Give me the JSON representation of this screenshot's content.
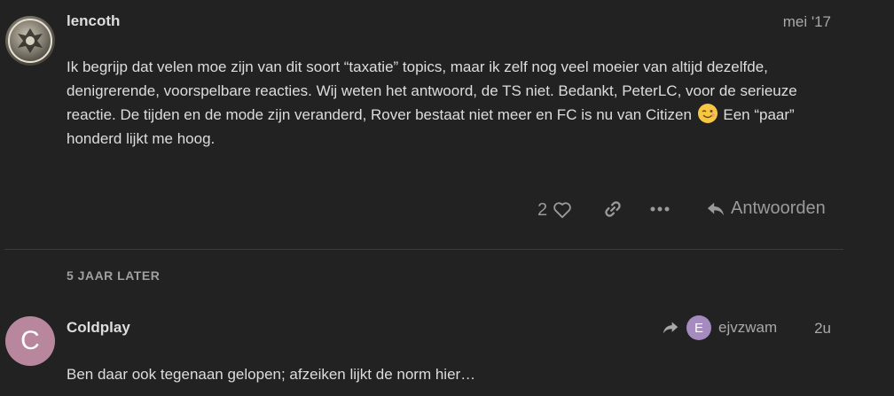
{
  "post1": {
    "username": "lencoth",
    "date": "mei '17",
    "body_before_emoji": "Ik begrijp dat velen moe zijn van dit soort “taxatie” topics, maar ik zelf nog veel moeier van altijd dezelfde, denigrerende, voorspelbare reacties. Wij weten het antwoord, de TS niet. Bedankt, PeterLC, voor de serieuze reactie. De tijden en de mode zijn veranderd, Rover bestaat niet meer en FC is nu van Citizen",
    "body_after_emoji": "Een “paar” honderd lijkt me hoog.",
    "emoji": "wink-emoji",
    "like_count": "2",
    "reply_label": "Antwoorden",
    "icons": [
      "heart-icon",
      "link-icon",
      "more-icon",
      "reply-icon"
    ]
  },
  "time_gap": "5 JAAR LATER",
  "post2": {
    "username": "Coldplay",
    "avatar_letter": "C",
    "avatar_color": "#b9879d",
    "reply_to_letter": "E",
    "reply_to_user": "ejvzwam",
    "reply_to_color": "#a58bbf",
    "date": "2u",
    "body": "Ben daar ook tegenaan gelopen; afzeiken lijkt de norm hier…"
  },
  "colors": {
    "background": "#222222",
    "text": "#dddddd",
    "muted": "#9a9a9a",
    "emoji": "#f7c643"
  }
}
